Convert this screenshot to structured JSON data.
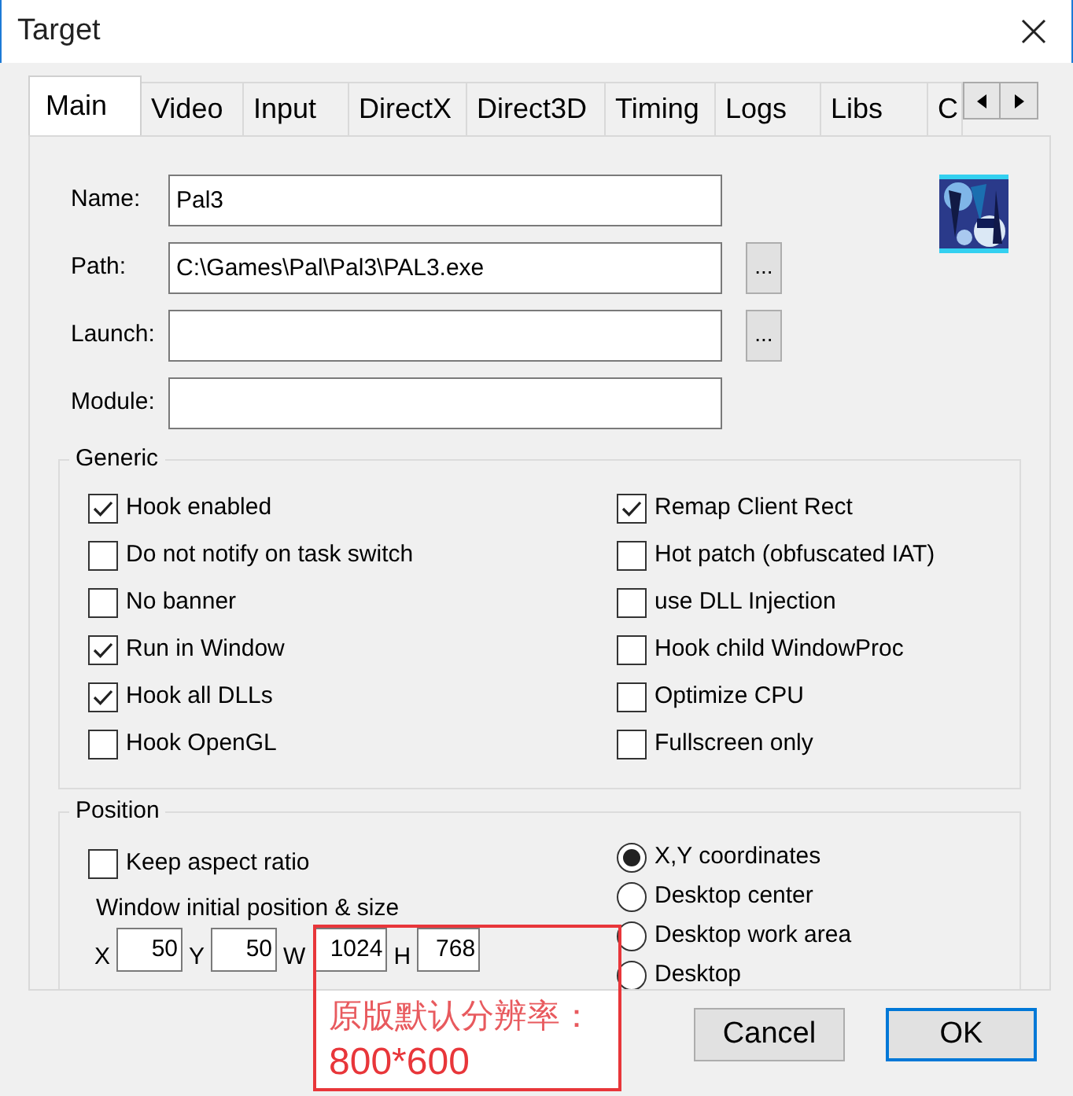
{
  "window": {
    "title": "Target"
  },
  "tabs": [
    {
      "label": "Main",
      "selected": true
    },
    {
      "label": "Video",
      "selected": false
    },
    {
      "label": "Input",
      "selected": false
    },
    {
      "label": "DirectX",
      "selected": false
    },
    {
      "label": "Direct3D",
      "selected": false
    },
    {
      "label": "Timing",
      "selected": false
    },
    {
      "label": "Logs",
      "selected": false
    },
    {
      "label": "Libs",
      "selected": false
    },
    {
      "label": "C",
      "selected": false
    }
  ],
  "fields": [
    {
      "label": "Name:",
      "value": "Pal3",
      "browse": false
    },
    {
      "label": "Path:",
      "value": "C:\\Games\\Pal\\Pal3\\PAL3.exe",
      "browse": true
    },
    {
      "label": "Launch:",
      "browse": true
    },
    {
      "label": "Module:",
      "browse": false
    }
  ],
  "browse_label": "...",
  "generic": {
    "title": "Generic",
    "columns": [
      [
        {
          "label": "Hook enabled",
          "checked": true
        },
        {
          "label": "Do not notify on task switch",
          "checked": false
        },
        {
          "label": "No banner",
          "checked": false
        },
        {
          "label": "Run in Window",
          "checked": true
        },
        {
          "label": "Hook all DLLs",
          "checked": true
        },
        {
          "label": "Hook OpenGL",
          "checked": false
        }
      ],
      [
        {
          "label": "Remap Client Rect",
          "checked": true
        },
        {
          "label": "Hot patch (obfuscated IAT)",
          "checked": false
        },
        {
          "label": "use DLL Injection",
          "checked": false
        },
        {
          "label": "Hook child WindowProc",
          "checked": false
        },
        {
          "label": "Optimize CPU",
          "checked": false
        },
        {
          "label": "Fullscreen only",
          "checked": false
        }
      ]
    ]
  },
  "position": {
    "title": "Position",
    "keep_aspect": {
      "label": "Keep aspect ratio",
      "checked": false
    },
    "caption": "Window initial position & size",
    "coords": [
      {
        "label": "X",
        "value": "50"
      },
      {
        "label": "Y",
        "value": "50"
      },
      {
        "label": "W",
        "value": "1024"
      },
      {
        "label": "H",
        "value": "768"
      }
    ],
    "modes": [
      {
        "label": "X,Y coordinates",
        "selected": true
      },
      {
        "label": "Desktop center",
        "selected": false
      },
      {
        "label": "Desktop work area",
        "selected": false
      },
      {
        "label": "Desktop",
        "selected": false
      }
    ]
  },
  "buttons": [
    {
      "label": "Cancel",
      "default": false
    },
    {
      "label": "OK",
      "default": true
    }
  ],
  "annotation": {
    "lines": [
      "原版默认分辨率：",
      "800*600"
    ]
  }
}
